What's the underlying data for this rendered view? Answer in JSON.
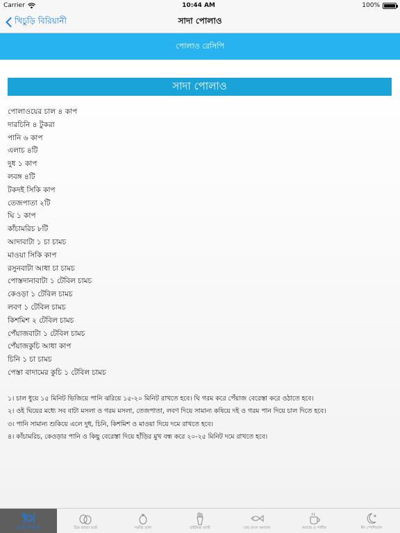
{
  "status_bar": {
    "carrier": "Carrier",
    "time": "10:44 AM",
    "battery_text": "100%",
    "battery_level": 1.0
  },
  "nav": {
    "back_label": "খিচুড়ি বিরিয়ানী",
    "title": "সাদা পোলাও"
  },
  "banner": {
    "text": "পোলাও রেসিপি"
  },
  "recipe": {
    "title": "সাদা পোলাও",
    "ingredients": [
      "পোলাওয়ের চাল ৪ কাপ",
      "দারচিনি ৪ টুকরা",
      "পানি ৬ কাপ",
      "এলাচ ৪টি",
      "দুধ ১ কাপ",
      "লবঙ্গ ৪টি",
      "টকদই সিকি কাপ",
      "তেজপাতা ২টি",
      "ঘি ১ কাপ",
      "কাঁচামরিচ ৮টি",
      "আদাবাটা ১ চা চামচ",
      "মাওয়া সিকি কাপ",
      "রসুনবাটা আধা চা চামচ",
      "পোস্তদানাবাটা ১ টেবিল চামচ",
      "কেওড়া ১ টেবিল চামচ",
      "লবণ ১ টেবিল চামচ",
      "কিশমিশ ২ টেবিল চামচ",
      "পেঁয়াজবাটা ১ টেবিল চামচ",
      "পেঁয়াজকুচি আধা কাপ",
      "চিনি ১ চা চামচ",
      "পেস্তা বাদামের কুচি ১ টেবিল চামচ"
    ],
    "steps": [
      "১। চাল ধুয়ে ১৫ মিনিট ভিজিয়ে পানি ঝরিয়ে ১৫-২০ মিনিট রাখতে হবে। ঘি গরম করে পেঁয়াজ বেরেস্তা করে ওঠাতে হবে।",
      "২। ওই ঘিয়ের মধ্যে সব বাটা মসলা ও গরম মসলা, তেজপাতা, লবণ দিয়ে সামান্য কষিয়ে দই ও গরম পান দিয়ে চাল দিতে হবে।",
      "৩। পানি সামান্য শুকিয়ে এলে দুধ, চিনি, কিশমিশ ও মাওয়া দিয়ে দমে রাখতে হবে।",
      "৪। কাঁচামরিচ, কেওড়ার পানি ও কিছু বেরেস্তা দিয়ে হাঁড়ির মুখ বন্ধ করে ২০-২৫ মিনিট দমে রাখতে হবে।"
    ]
  },
  "tabs": [
    {
      "label": "খিচুড়ি বিরিয়ানী",
      "icon": "plate-cutlery-icon",
      "active": true
    },
    {
      "label": "ডিম ভাজা ভর্তা",
      "icon": "eggs-icon",
      "active": false
    },
    {
      "label": "সবজি ডাল",
      "icon": "vegetable-icon",
      "active": false
    },
    {
      "label": "চাইনিজ ফাস্ট",
      "icon": "fries-icon",
      "active": false
    },
    {
      "label": "মাছ মাংস অন্যান্য",
      "icon": "fish-icon",
      "active": false
    },
    {
      "label": "আচার ও পানীয়",
      "icon": "cup-icon",
      "active": false
    },
    {
      "label": "ঈদ স্পেশিয়াল",
      "icon": "crescent-icon",
      "active": false
    }
  ],
  "colors": {
    "accent": "#1a7ef2",
    "banner": "#27b2f0",
    "title_bar": "#1aa3d8",
    "tab_active_bg": "#5e5e5e"
  }
}
